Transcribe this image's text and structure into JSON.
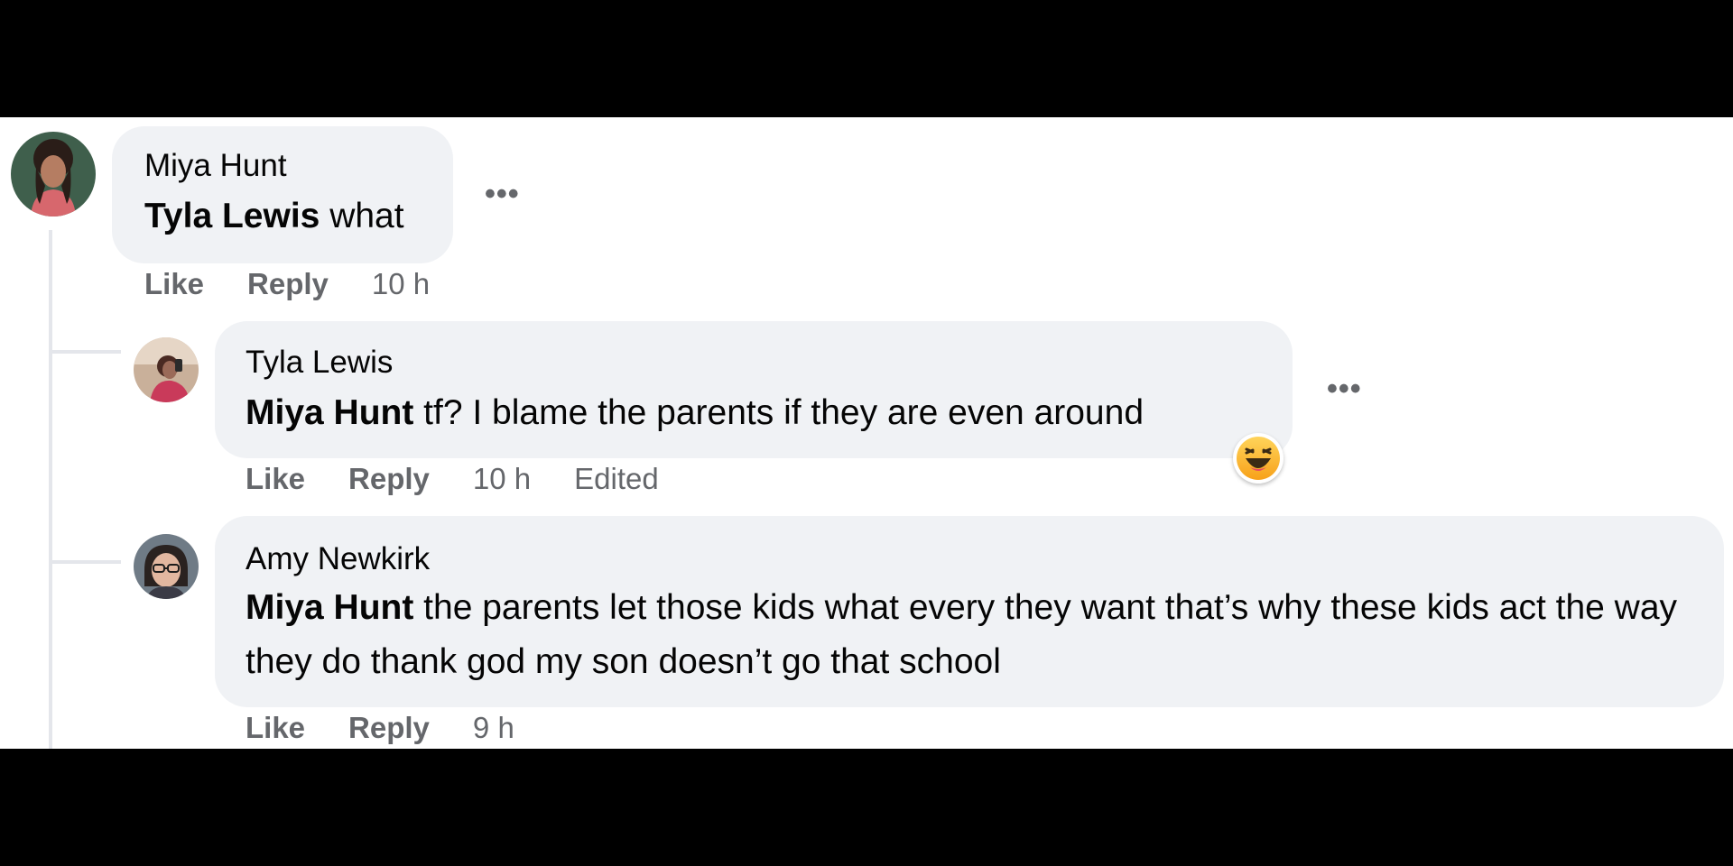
{
  "comments": [
    {
      "author": "Miya Hunt",
      "mention": "Tyla Lewis",
      "text": " what",
      "like_label": "Like",
      "reply_label": "Reply",
      "time": "10 h"
    },
    {
      "author": "Tyla Lewis",
      "mention": "Miya Hunt",
      "text": " tf? I blame the parents if they are even around",
      "like_label": "Like",
      "reply_label": "Reply",
      "time": "10 h",
      "edited": "Edited",
      "reaction": "haha-emoji-icon"
    },
    {
      "author": "Amy Newkirk",
      "mention": "Miya Hunt",
      "text": " the parents let those kids what every they want that’s why these kids act the way they do thank god my son doesn’t go that school",
      "like_label": "Like",
      "reply_label": "Reply",
      "time": "9 h"
    }
  ],
  "more_icon": "more-options-icon",
  "colors": {
    "bubble": "#f0f2f5",
    "text": "#050505",
    "meta": "#65676b",
    "thread_line": "#e4e6eb",
    "letterbox": "#000000"
  }
}
